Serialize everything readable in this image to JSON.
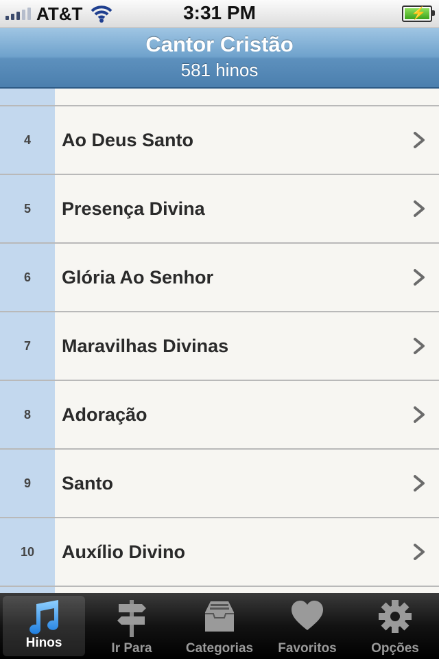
{
  "status_bar": {
    "carrier": "AT&T",
    "time": "3:31 PM",
    "signal_bars": 3,
    "signal_total": 5,
    "battery_charging": true
  },
  "nav": {
    "title": "Cantor Cristão",
    "subtitle": "581 hinos"
  },
  "list": {
    "items": [
      {
        "number": "4",
        "title": "Ao Deus Santo"
      },
      {
        "number": "5",
        "title": "Presença Divina"
      },
      {
        "number": "6",
        "title": "Glória Ao Senhor"
      },
      {
        "number": "7",
        "title": "Maravilhas Divinas"
      },
      {
        "number": "8",
        "title": "Adoração"
      },
      {
        "number": "9",
        "title": "Santo"
      },
      {
        "number": "10",
        "title": "Auxílio Divino"
      }
    ]
  },
  "tabs": [
    {
      "label": "Hinos",
      "icon": "music-note-icon",
      "active": true
    },
    {
      "label": "Ir Para",
      "icon": "signpost-icon",
      "active": false
    },
    {
      "label": "Categorias",
      "icon": "inbox-tray-icon",
      "active": false
    },
    {
      "label": "Favoritos",
      "icon": "heart-icon",
      "active": false
    },
    {
      "label": "Opções",
      "icon": "gear-icon",
      "active": false
    }
  ],
  "colors": {
    "nav_bar": "#5d90bd",
    "number_column": "#c3d8ee",
    "row_background": "#f7f6f2",
    "tab_active_icon": "#2f8de6"
  }
}
